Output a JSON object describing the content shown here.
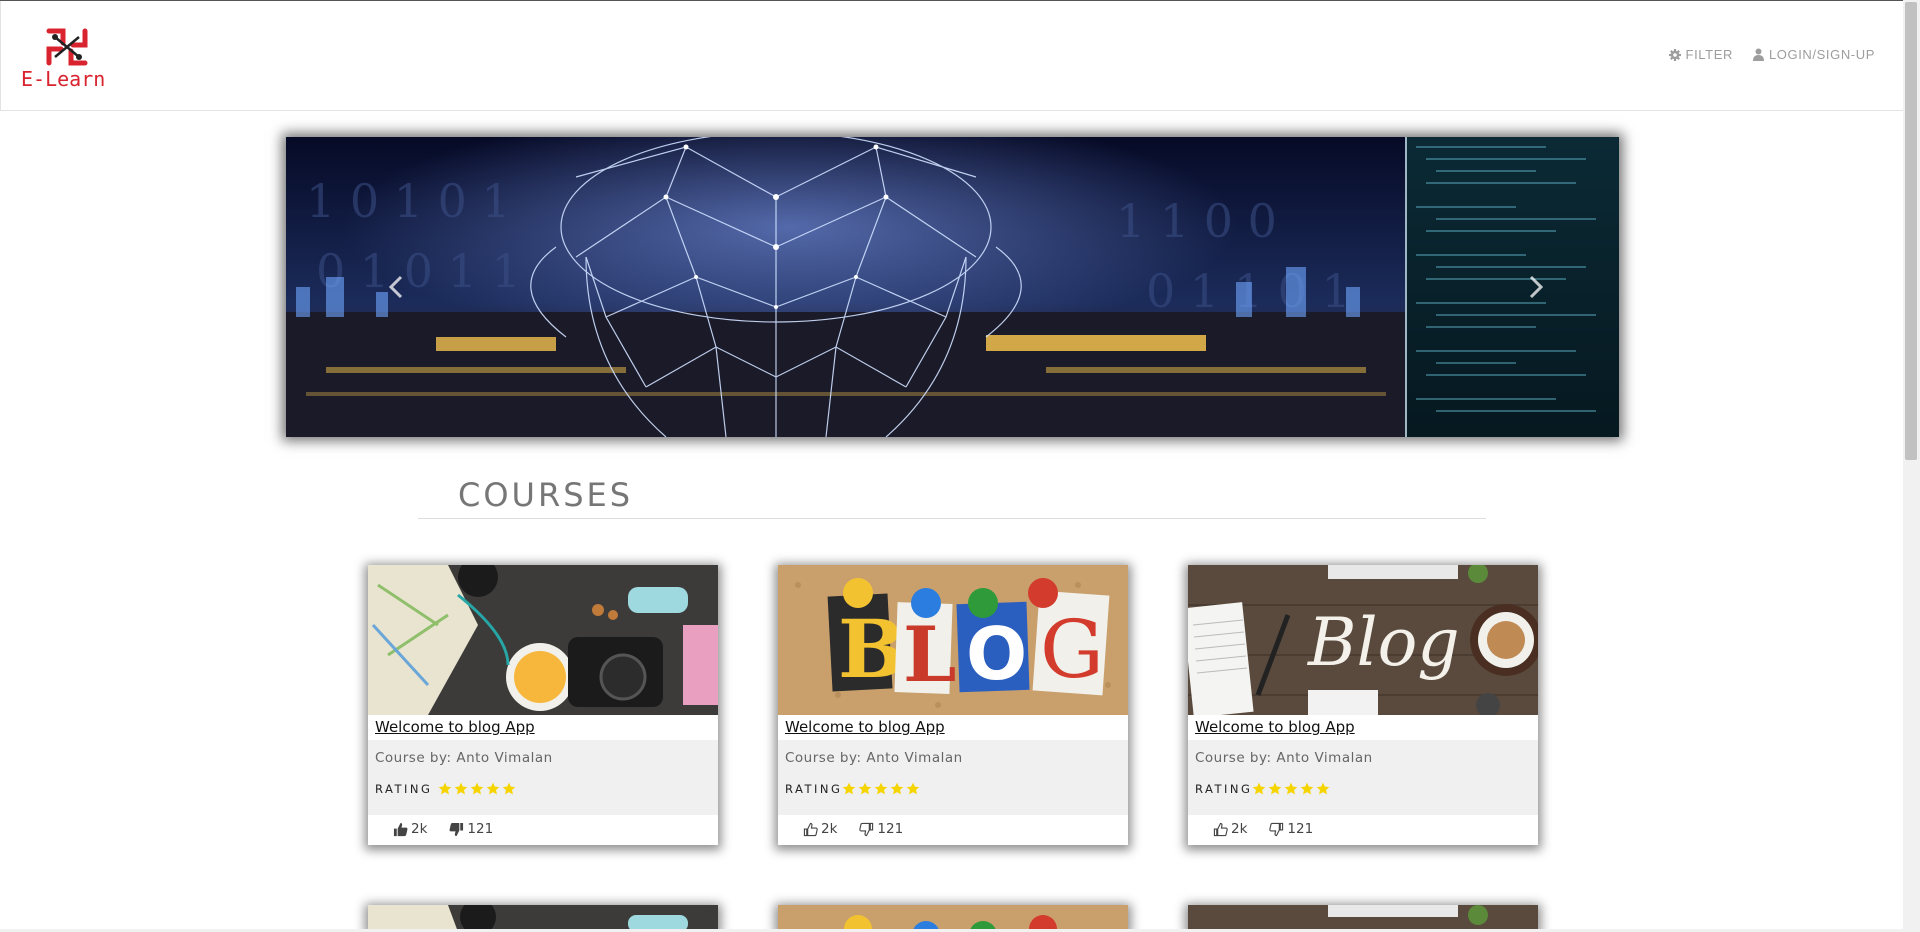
{
  "brand": {
    "name": "E-Learn",
    "color": "#d9232e"
  },
  "nav": {
    "filter_label": "FILTER",
    "filter_icon": "gear-icon",
    "login_label": "LOGIN/SIGN-UP",
    "login_icon": "user-icon"
  },
  "carousel": {
    "prev_icon": "chevron-left-icon",
    "next_icon": "chevron-right-icon"
  },
  "section": {
    "title": "COURSES"
  },
  "colors": {
    "star": "#f5d400",
    "accent": "#d9232e"
  },
  "courses": [
    {
      "title": "Welcome to blog App",
      "author": "Course by: Anto Vimalan",
      "rating_label": "RATING",
      "stars": 5,
      "likes": "2k",
      "dislikes": "121",
      "image": "travel-desk-photo"
    },
    {
      "title": "Welcome to blog App",
      "author": "Course by: Anto Vimalan",
      "rating_label": "RATING",
      "stars": 5,
      "likes": "2k",
      "dislikes": "121",
      "image": "blog-letters-photo"
    },
    {
      "title": "Welcome to blog App",
      "author": "Course by: Anto Vimalan",
      "rating_label": "RATING",
      "stars": 5,
      "likes": "2k",
      "dislikes": "121",
      "image": "blog-desk-photo"
    }
  ]
}
